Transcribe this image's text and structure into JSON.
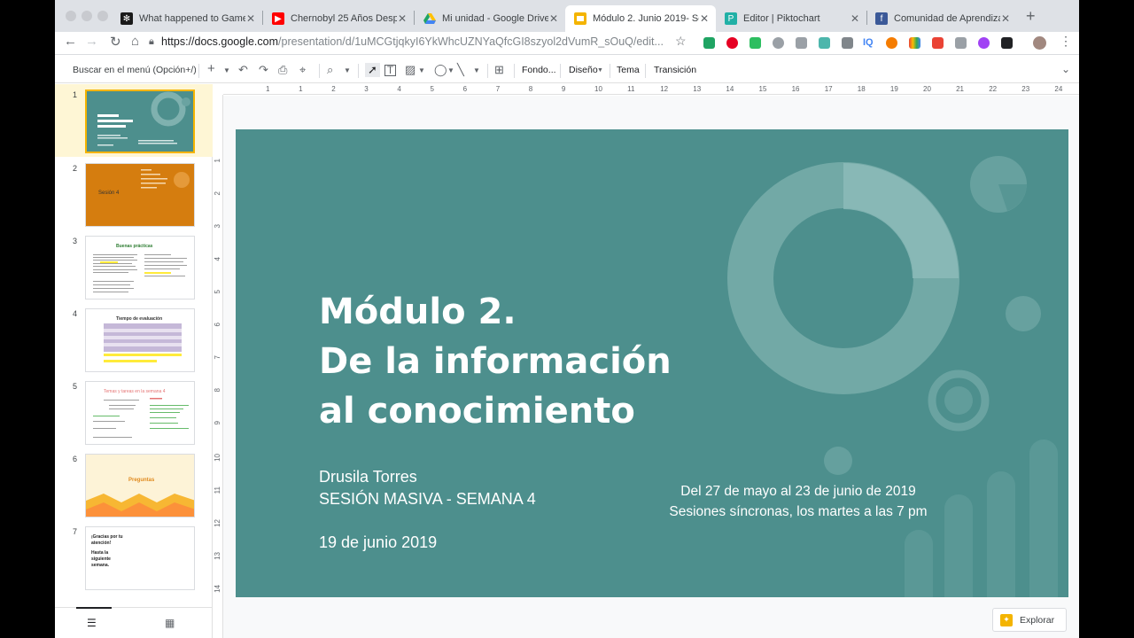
{
  "browser": {
    "tabs": [
      {
        "title": "What happened to Game",
        "favicon": "snowflake-icon",
        "color": "#1a1a1a"
      },
      {
        "title": "Chernobyl 25 Años Desp",
        "favicon": "youtube-icon",
        "color": "#ff0000"
      },
      {
        "title": "Mi unidad - Google Drive",
        "favicon": "drive-icon",
        "color": "#1fa463"
      },
      {
        "title": "Módulo 2. Junio 2019- Se",
        "favicon": "slides-icon",
        "color": "#f4b400"
      },
      {
        "title": "Editor | Piktochart",
        "favicon": "piktochart-icon",
        "color": "#21b0a6"
      },
      {
        "title": "Comunidad de Aprendiza",
        "favicon": "facebook-icon",
        "color": "#3b5998"
      }
    ],
    "url_host": "https://docs.google.com",
    "url_path": "/presentation/d/1uMCGtjqkyI6YkWhcUZNYaQfcGI8szyol2dVumR_sOuQ/edit..."
  },
  "toolbar": {
    "menu_search": "Buscar en el menú (Opción+/)",
    "background": "Fondo...",
    "layout": "Diseño",
    "theme": "Tema",
    "transition": "Transición"
  },
  "filmstrip": {
    "slides": [
      {
        "num": "1",
        "bg": "#4d8f8d"
      },
      {
        "num": "2",
        "bg": "#d57d0f",
        "label": "Sesión 4"
      },
      {
        "num": "3",
        "bg": "#ffffff",
        "label": "Buenas prácticas"
      },
      {
        "num": "4",
        "bg": "#ffffff",
        "label": "Tiempo de evaluación"
      },
      {
        "num": "5",
        "bg": "#ffffff",
        "label": "Temas y tareas en la semana 4"
      },
      {
        "num": "6",
        "bg": "#fdf3d7",
        "label": "Preguntas"
      },
      {
        "num": "7",
        "bg": "#ffffff",
        "label1": "¡Gracias por tu atención!",
        "label2": "Hasta la siguiente semana."
      }
    ]
  },
  "ruler": {
    "h": [
      "1",
      "1",
      "2",
      "3",
      "4",
      "5",
      "6",
      "7",
      "8",
      "9",
      "10",
      "11",
      "12",
      "13",
      "14",
      "15",
      "16",
      "17",
      "18",
      "19",
      "20",
      "21",
      "22",
      "23",
      "24",
      "25"
    ],
    "v": [
      "1",
      "2",
      "3",
      "4",
      "5",
      "6",
      "7",
      "8",
      "9",
      "10",
      "11",
      "12",
      "13",
      "14"
    ]
  },
  "slide": {
    "title_line1": "Módulo 2.",
    "title_line2": "De la información",
    "title_line3": "al conocimiento",
    "author_line1": "Drusila Torres",
    "author_line2": "SESIÓN MASIVA - SEMANA 4",
    "date": "19 de junio 2019",
    "period_line1": "Del 27 de mayo al 23 de junio de 2019",
    "period_line2": "Sesiones síncronas, los martes a las 7 pm",
    "bg_color": "#4d8f8d"
  },
  "explore_label": "Explorar"
}
